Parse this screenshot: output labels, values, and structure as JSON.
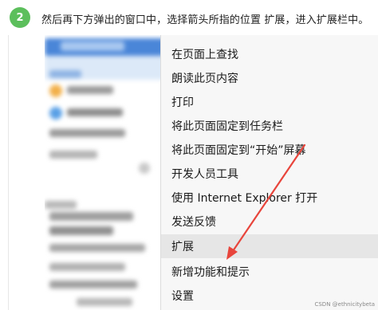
{
  "step": {
    "number": "2",
    "instruction": "然后再下方弹出的窗口中，选择箭头所指的位置 扩展，进入扩展栏中。"
  },
  "context_menu": {
    "items": [
      {
        "label": "在页面上查找"
      },
      {
        "label": "朗读此页内容"
      },
      {
        "label": "打印"
      },
      {
        "label": "将此页面固定到任务栏"
      },
      {
        "label": "将此页面固定到“开始”屏幕"
      },
      {
        "label": "开发人员工具"
      },
      {
        "label": "使用 Internet Explorer 打开"
      },
      {
        "label": "发送反馈"
      },
      {
        "label": "扩展",
        "highlighted": true
      },
      {
        "label": "新增功能和提示"
      },
      {
        "label": "设置"
      }
    ]
  },
  "annotation": {
    "arrow_color": "#e8453c",
    "points_to": "扩展"
  },
  "watermark": "CSDN @ethnicitybeta",
  "colors": {
    "step_badge": "#5cbf5c",
    "menu_background": "#f7f7f7",
    "menu_highlight": "#e6e6e6"
  }
}
